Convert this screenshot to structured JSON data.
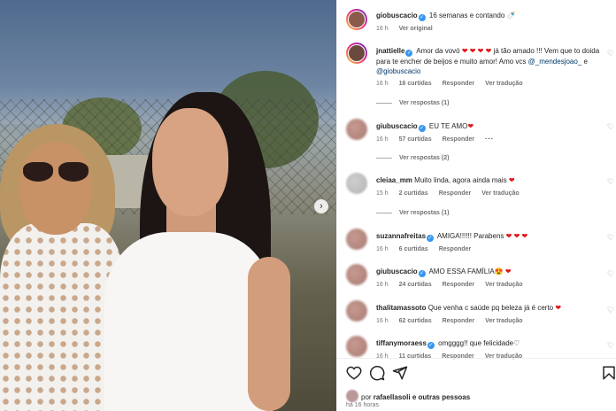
{
  "colors": {
    "link": "#00376b",
    "verified": "#3797f0",
    "heart": "#e0161a",
    "muted": "#737373"
  },
  "post": {
    "author": "giobuscacio",
    "caption": "16 semanas e contando 🍼",
    "time": "16 h",
    "see_original": "Ver original"
  },
  "comments": [
    {
      "user": "jnattielle",
      "text_a": "Amor da vovó",
      "hearts": "❤ ❤ ❤ ❤",
      "text_b": "já tão amado !!! Vem que to doida para te encher de beijos e muito amor! Amo vcs",
      "mention1": "@_mendesjoao_",
      "conj": "e",
      "mention2": "@giobuscacio",
      "time": "16 h",
      "likes": "16 curtidas",
      "reply": "Responder",
      "translate": "Ver tradução",
      "view_replies": "Ver respostas (1)"
    },
    {
      "user": "giubuscacio",
      "text": "EU TE AMO",
      "hearts": "❤",
      "time": "16 h",
      "likes": "57 curtidas",
      "reply": "Responder",
      "more": "···",
      "view_replies": "Ver respostas (2)"
    },
    {
      "user": "cleiaa_mm",
      "text": "Muito linda, agora ainda mais",
      "hearts": "❤",
      "time": "15 h",
      "likes": "2 curtidas",
      "reply": "Responder",
      "translate": "Ver tradução",
      "view_replies": "Ver respostas (1)"
    },
    {
      "user": "suzannafreitas",
      "text": "AMIGA!!!!!! Parabens",
      "hearts": "❤ ❤ ❤",
      "time": "16 h",
      "likes": "6 curtidas",
      "reply": "Responder"
    },
    {
      "user": "giubuscacio",
      "text": "AMO ESSA FAMÍLIA",
      "hearts": "😍 ❤",
      "time": "16 h",
      "likes": "24 curtidas",
      "reply": "Responder",
      "translate": "Ver tradução"
    },
    {
      "user": "thalitamassoto",
      "text": "Que venha c saúde pq beleza já é certo",
      "hearts": "❤",
      "time": "16 h",
      "likes": "62 curtidas",
      "reply": "Responder",
      "translate": "Ver tradução"
    },
    {
      "user": "tiffanymoraess",
      "text": "omgggg!! que felicidade",
      "hearts": "♡",
      "time": "16 h",
      "likes": "11 curtidas",
      "reply": "Responder",
      "translate": "Ver tradução"
    }
  ],
  "footer": {
    "liked_prefix": "por",
    "liked_user": "rafaellasoli",
    "liked_suffix": "e outras pessoas",
    "time_ago": "há 16 horas"
  },
  "icons": {
    "like": "heart-outline-icon",
    "comment": "comment-icon",
    "share": "share-icon",
    "save": "bookmark-icon",
    "carousel": "chevron-right-icon"
  }
}
